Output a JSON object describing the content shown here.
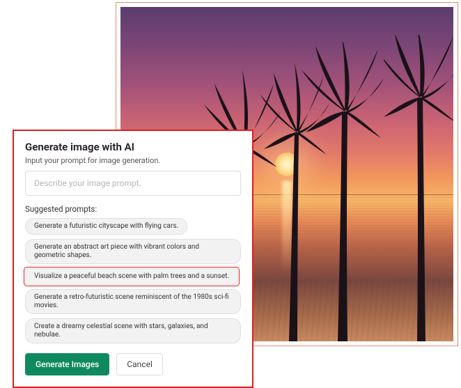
{
  "dialog": {
    "title": "Generate image with AI",
    "subtitle": "Input your prompt for image generation.",
    "placeholder": "Describe your image prompt.",
    "suggested_label": "Suggested prompts:",
    "suggestions": [
      "Generate a futuristic cityscape with flying cars.",
      "Generate an abstract art piece with vibrant colors and geometric shapes.",
      "Visualize a peaceful beach scene with palm trees and a sunset.",
      "Generate a retro-futuristic scene reminiscent of the 1980s sci-fi movies.",
      "Create a dreamy celestial scene with stars, galaxies, and nebulae."
    ],
    "highlighted_index": 2,
    "generate_label": "Generate Images",
    "cancel_label": "Cancel"
  },
  "preview": {
    "description": "Sunset beach with palm tree silhouettes"
  }
}
